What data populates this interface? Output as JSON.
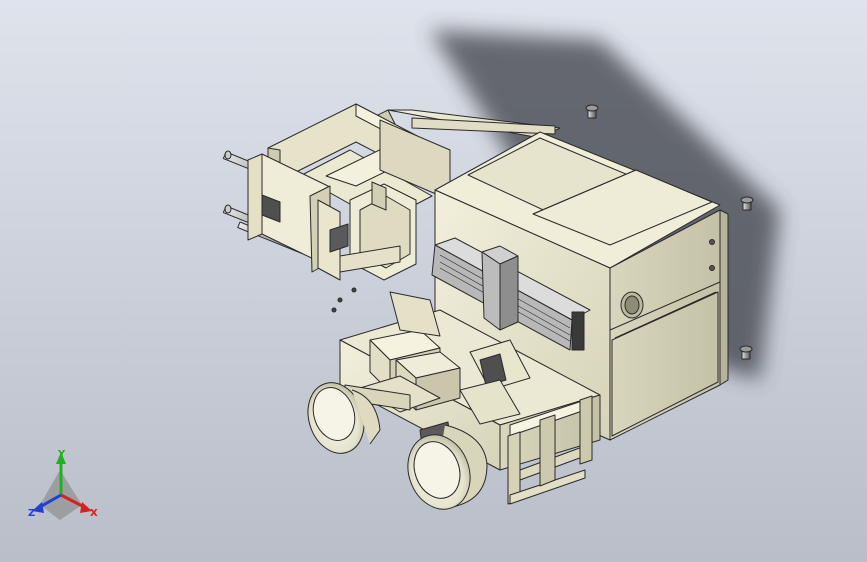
{
  "viewport": {
    "background_top": "#dfe3ec",
    "background_bottom": "#b9bec9",
    "model_color": "#e8e6cf",
    "edge_color": "#2a2a2a"
  },
  "triad": {
    "x_label": "X",
    "y_label": "Y",
    "z_label": "Z",
    "x_color": "#d92020",
    "y_color": "#20b020",
    "z_color": "#2040d0"
  }
}
